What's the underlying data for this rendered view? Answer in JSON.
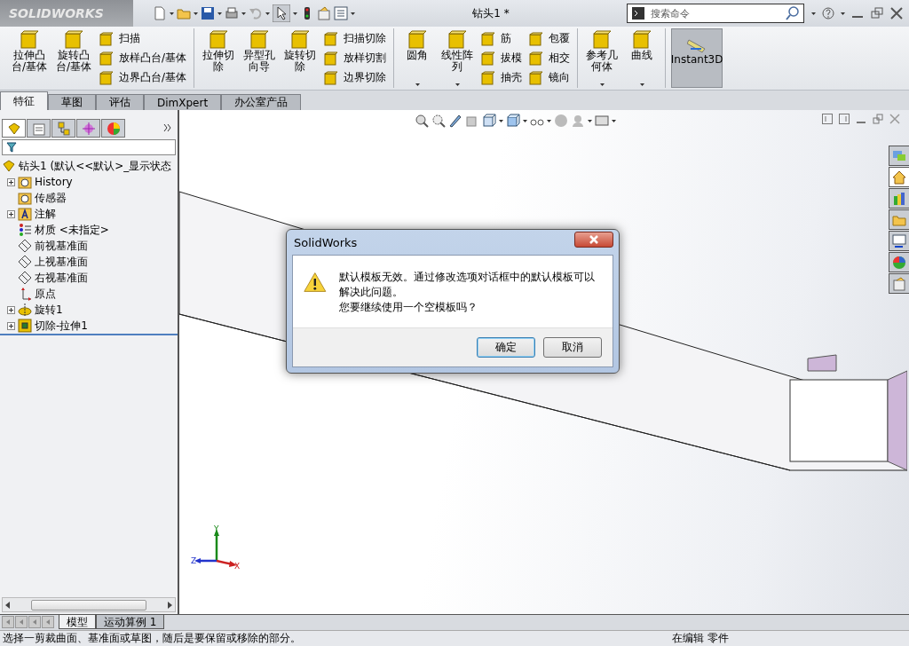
{
  "window": {
    "logo": "SOLIDWORKS",
    "title": "钻头1 *",
    "search": {
      "placeholder": "搜索命令"
    }
  },
  "ribbon": {
    "groups": [
      {
        "columns": [
          {
            "kind": "large",
            "lines": [
              "拉伸凸",
              "台/基体"
            ],
            "dropdown": false
          },
          {
            "kind": "large",
            "lines": [
              "旋转凸",
              "台/基体"
            ],
            "dropdown": false
          },
          {
            "kind": "stack",
            "items": [
              "扫描",
              "放样凸台/基体",
              "边界凸台/基体"
            ]
          }
        ]
      },
      {
        "columns": [
          {
            "kind": "large",
            "lines": [
              "拉伸切",
              "除"
            ],
            "dropdown": false
          },
          {
            "kind": "large",
            "lines": [
              "异型孔",
              "向导"
            ],
            "dropdown": false
          },
          {
            "kind": "large",
            "lines": [
              "旋转切",
              "除"
            ],
            "dropdown": false
          },
          {
            "kind": "stack",
            "items": [
              "扫描切除",
              "放样切割",
              "边界切除"
            ]
          }
        ]
      },
      {
        "columns": [
          {
            "kind": "large",
            "lines": [
              "圆角"
            ],
            "dropdown": true
          },
          {
            "kind": "large",
            "lines": [
              "线性阵",
              "列"
            ],
            "dropdown": true
          },
          {
            "kind": "stack",
            "items": [
              "筋",
              "拔模",
              "抽壳"
            ]
          },
          {
            "kind": "stack",
            "items": [
              "包覆",
              "相交",
              "镜向"
            ]
          }
        ]
      },
      {
        "columns": [
          {
            "kind": "large",
            "lines": [
              "参考几",
              "何体"
            ],
            "dropdown": true
          },
          {
            "kind": "large",
            "lines": [
              "曲线"
            ],
            "dropdown": true
          }
        ]
      },
      {
        "columns": [
          {
            "kind": "toggle",
            "lines": [
              "Instant3D"
            ],
            "selected": true
          }
        ]
      }
    ]
  },
  "tabs": [
    {
      "label": "特征",
      "selected": true
    },
    {
      "label": "草图",
      "selected": false
    },
    {
      "label": "评估",
      "selected": false
    },
    {
      "label": "DimXpert",
      "selected": false
    },
    {
      "label": "办公室产品",
      "selected": false
    }
  ],
  "feature_manager": {
    "panel_tabs": [
      {
        "selected": true
      },
      {
        "selected": false
      },
      {
        "selected": false
      },
      {
        "selected": false
      },
      {
        "selected": false
      }
    ],
    "tree": {
      "label": "钻头1  (默认<<默认>_显示状态",
      "children": [
        {
          "kind": "history",
          "label": "History",
          "collapsed": true
        },
        {
          "kind": "sensor",
          "label": "传感器",
          "collapsed": false
        },
        {
          "kind": "annotation",
          "label": "注解",
          "collapsed": true
        },
        {
          "kind": "material",
          "label": "材质 <未指定>",
          "collapsed": false
        },
        {
          "kind": "plane",
          "label": "前视基准面",
          "collapsed": false
        },
        {
          "kind": "plane",
          "label": "上视基准面",
          "collapsed": false
        },
        {
          "kind": "plane",
          "label": "右视基准面",
          "collapsed": false
        },
        {
          "kind": "origin",
          "label": "原点",
          "collapsed": false
        },
        {
          "kind": "revolve",
          "label": "旋转1",
          "collapsed": true
        },
        {
          "kind": "cut",
          "label": "切除-拉伸1",
          "collapsed": true
        }
      ]
    }
  },
  "viewport": {
    "triad": [
      {
        "label": "Y",
        "color": "#1a8a1a"
      },
      {
        "label": "Z",
        "color": "#2233cc"
      },
      {
        "label": "X",
        "color": "#cc2222"
      }
    ],
    "task_pane_tabs": [
      {
        "selected": false
      },
      {
        "selected": true
      },
      {
        "selected": false
      },
      {
        "selected": false
      },
      {
        "selected": false
      },
      {
        "selected": false
      },
      {
        "selected": false
      }
    ]
  },
  "dialog": {
    "title": "SolidWorks",
    "message": [
      "默认模板无效。通过修改选项对话框中的默认模板可以解决此问题。",
      "您要继续使用一个空模板吗？"
    ],
    "buttons": [
      {
        "label": "确定",
        "default": true
      },
      {
        "label": "取消",
        "default": false
      }
    ]
  },
  "bottom_tabs": [
    {
      "label": "模型",
      "selected": true
    },
    {
      "label": "运动算例 1",
      "selected": false
    }
  ],
  "status_bar": {
    "message": "选择一剪裁曲面、基准面或草图，随后是要保留或移除的部分。",
    "mode": "在编辑 零件"
  }
}
